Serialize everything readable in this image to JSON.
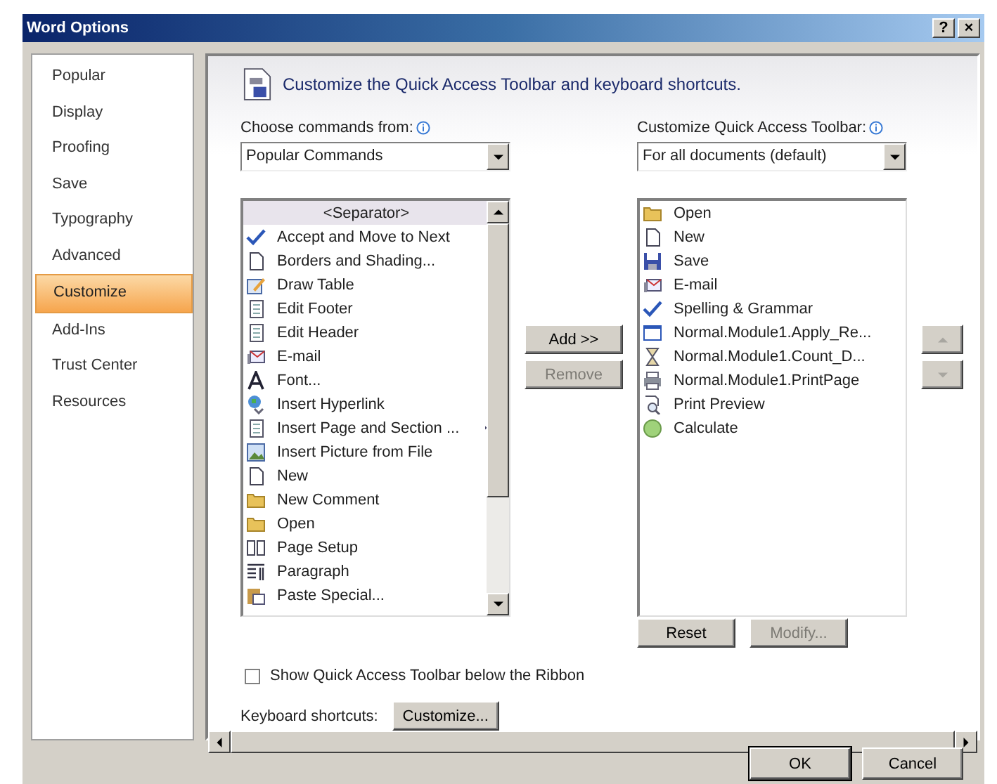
{
  "window": {
    "title": "Word Options",
    "help_button": "?",
    "close_button": "×"
  },
  "sidebar": {
    "items": [
      {
        "label": "Popular",
        "selected": false
      },
      {
        "label": "Display",
        "selected": false
      },
      {
        "label": "Proofing",
        "selected": false
      },
      {
        "label": "Save",
        "selected": false
      },
      {
        "label": "Typography",
        "selected": false
      },
      {
        "label": "Advanced",
        "selected": false
      },
      {
        "label": "Customize",
        "selected": true
      },
      {
        "label": "Add-Ins",
        "selected": false
      },
      {
        "label": "Trust Center",
        "selected": false
      },
      {
        "label": "Resources",
        "selected": false
      }
    ]
  },
  "header": {
    "title": "Customize the Quick Access Toolbar and keyboard shortcuts."
  },
  "commands_from": {
    "label": "Choose commands from:",
    "value": "Popular Commands"
  },
  "toolbar_for": {
    "label": "Customize Quick Access Toolbar:",
    "value": "For all documents (default)"
  },
  "commands": [
    {
      "kind": "separator",
      "label": "<Separator>",
      "selected": true
    },
    {
      "kind": "command",
      "label": "Accept and Move to Next",
      "selected": false
    },
    {
      "kind": "command",
      "label": "Borders and Shading...",
      "selected": false
    },
    {
      "kind": "command",
      "label": "Draw Table",
      "selected": false
    },
    {
      "kind": "command",
      "label": "Edit Footer",
      "selected": false
    },
    {
      "kind": "command",
      "label": "Edit Header",
      "selected": false
    },
    {
      "kind": "command",
      "label": "E-mail",
      "selected": false
    },
    {
      "kind": "command",
      "label": "Font...",
      "selected": false
    },
    {
      "kind": "command",
      "label": "Insert Hyperlink",
      "selected": false
    },
    {
      "kind": "submenu",
      "label": "Insert Page and Section ...",
      "selected": false
    },
    {
      "kind": "command",
      "label": "Insert Picture from File",
      "selected": false
    },
    {
      "kind": "command",
      "label": "New",
      "selected": false
    },
    {
      "kind": "command",
      "label": "New Comment",
      "selected": false
    },
    {
      "kind": "command",
      "label": "Open",
      "selected": false
    },
    {
      "kind": "command",
      "label": "Page Setup",
      "selected": false
    },
    {
      "kind": "command",
      "label": "Paragraph",
      "selected": false
    },
    {
      "kind": "command",
      "label": "Paste Special...",
      "selected": false
    }
  ],
  "toolbar_items": [
    {
      "label": "Open",
      "selected": false
    },
    {
      "label": "New",
      "selected": false
    },
    {
      "label": "Save",
      "selected": false
    },
    {
      "label": "E-mail",
      "selected": false
    },
    {
      "label": "Spelling & Grammar",
      "selected": false
    },
    {
      "label": "Normal.Module1.Apply_Re...",
      "selected": false
    },
    {
      "label": "Normal.Module1.Count_D...",
      "selected": false
    },
    {
      "label": "Normal.Module1.PrintPage",
      "selected": false
    },
    {
      "label": "Print Preview",
      "selected": false
    },
    {
      "label": "Calculate",
      "selected": false
    }
  ],
  "add_button": {
    "label": "Add >>",
    "disabled": false
  },
  "remove_button": {
    "label": "Remove",
    "disabled": true
  },
  "move_up": {
    "disabled": true
  },
  "move_down": {
    "disabled": true
  },
  "reset_button": {
    "label": "Reset",
    "disabled": false
  },
  "modify_button": {
    "label": "Modify...",
    "disabled": true
  },
  "show_below_ribbon": {
    "label": "Show Quick Access Toolbar below the Ribbon",
    "checked": false
  },
  "keyboard": {
    "label": "Keyboard shortcuts:",
    "button": "Customize..."
  },
  "buttons": [
    {
      "label": "OK",
      "default": true
    },
    {
      "label": "Cancel",
      "default": false
    }
  ]
}
